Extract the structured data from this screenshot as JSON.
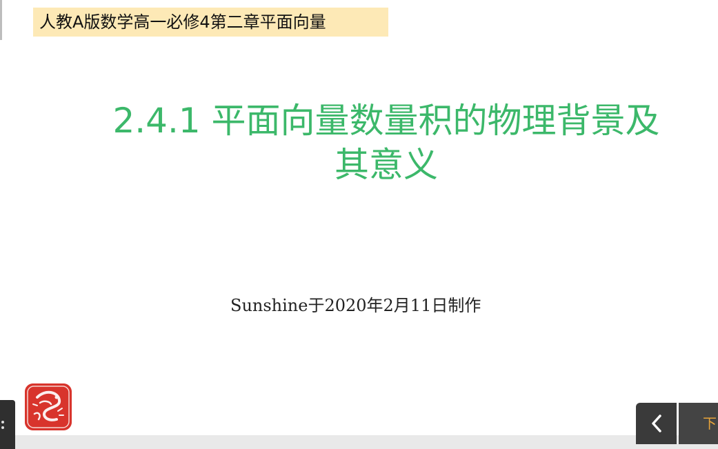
{
  "slide": {
    "course_tag": "人教A版数学高一必修4第二章平面向量",
    "title_line1": "2.4.1 平面向量数量积的物理背景及",
    "title_line2": "其意义",
    "credit": "Sunshine于2020年2月11日制作"
  },
  "nav": {
    "prev_icon": "chevron-left-icon",
    "next_label": "下"
  },
  "colors": {
    "title": "#3cb86a",
    "tag_bg": "#fde9b6",
    "seal": "#d8342c",
    "nav_bg": "#3a3a3a",
    "next_text": "#e8a43a"
  }
}
